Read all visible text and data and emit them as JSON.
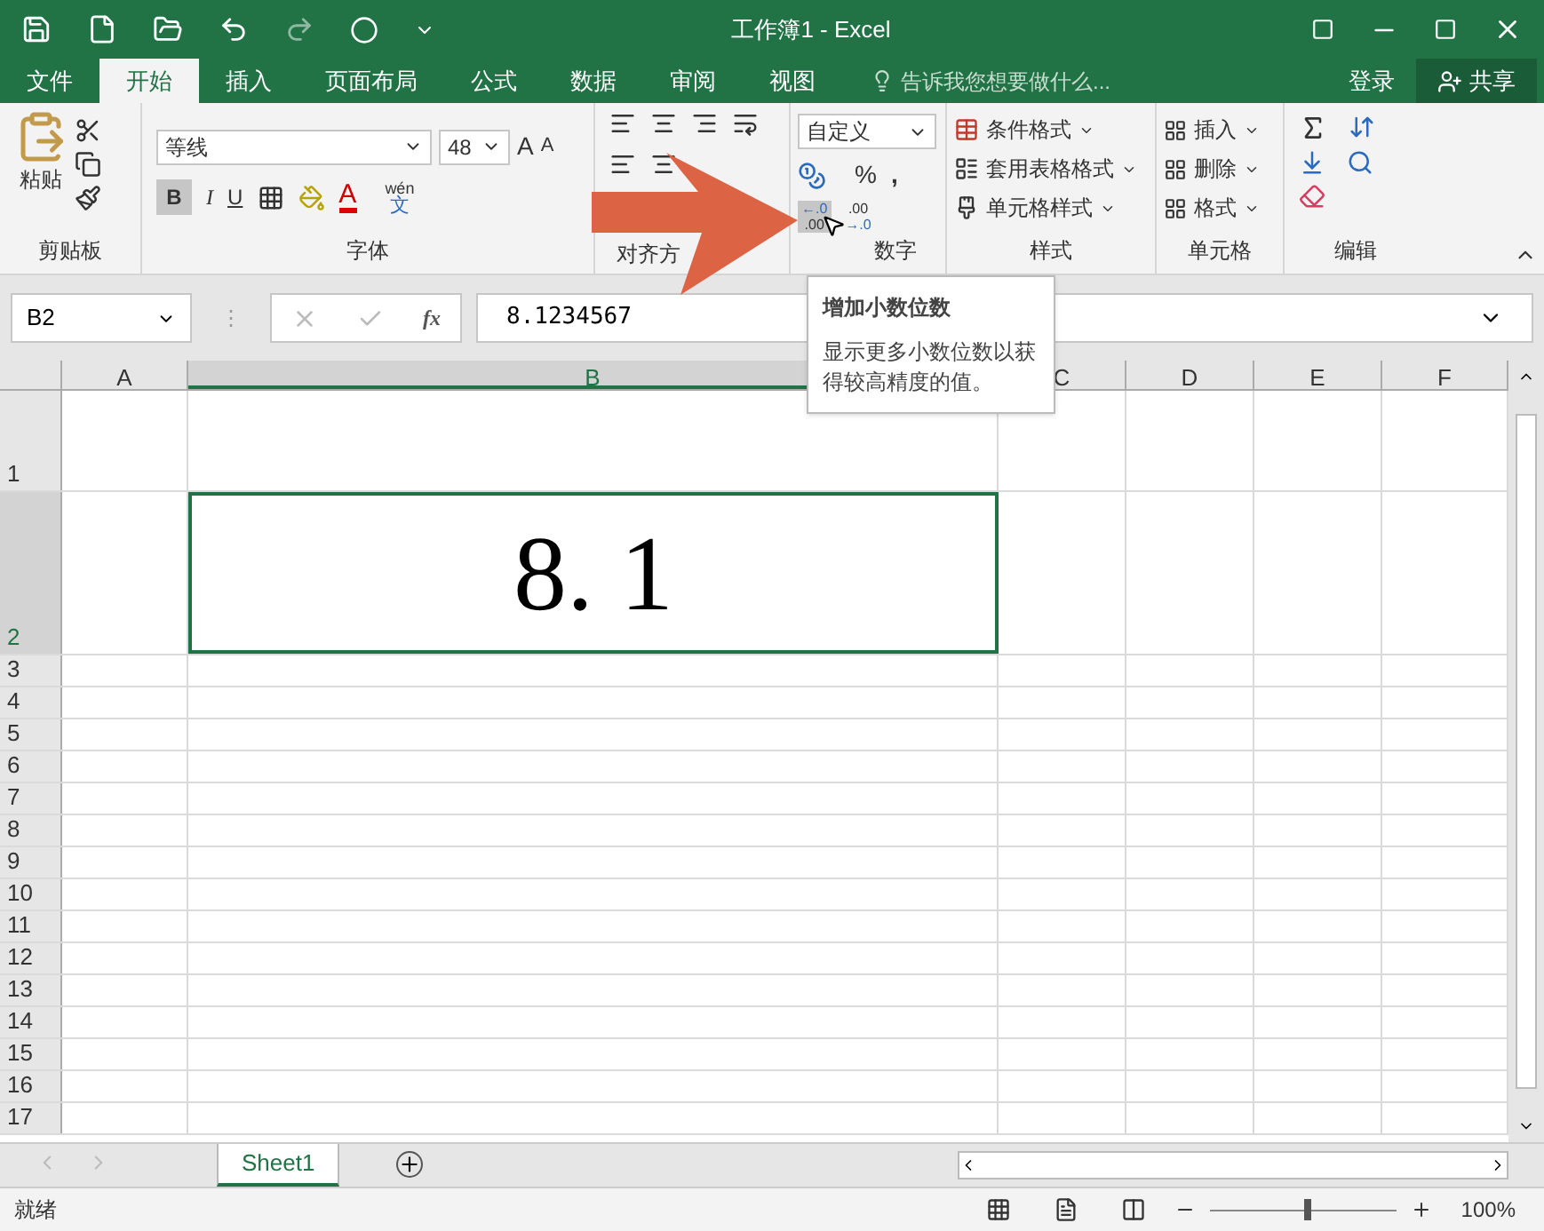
{
  "window": {
    "title": "工作簿1 - Excel"
  },
  "tabs": [
    {
      "label": "文件",
      "selected": false
    },
    {
      "label": "开始",
      "selected": true
    },
    {
      "label": "插入",
      "selected": false
    },
    {
      "label": "页面布局",
      "selected": false
    },
    {
      "label": "公式",
      "selected": false
    },
    {
      "label": "数据",
      "selected": false
    },
    {
      "label": "审阅",
      "selected": false
    },
    {
      "label": "视图",
      "selected": false
    }
  ],
  "tell_me": {
    "placeholder": "告诉我您想要做什么..."
  },
  "account": {
    "login": "登录",
    "share": "共享"
  },
  "ribbon": {
    "clipboard": {
      "paste": "粘贴",
      "label": "剪贴板"
    },
    "font": {
      "name": "等线",
      "size": "48",
      "grow": "A",
      "shrink": "A",
      "color_letter": "A",
      "bold": "B",
      "italic": "I",
      "underline": "U",
      "phonetic_top": "wén",
      "phonetic_bottom": "文",
      "label": "字体"
    },
    "alignment": {
      "label": "对齐方"
    },
    "number": {
      "format": "自定义",
      "percent": "%",
      "comma": ",",
      "increase_decimal_top": "←.0",
      "increase_decimal_bottom": ".00",
      "decrease_decimal_top": ".00",
      "decrease_decimal_bottom": "→.0",
      "label": "数字"
    },
    "styles": {
      "items": [
        "条件格式",
        "套用表格格式",
        "单元格样式"
      ],
      "label": "样式"
    },
    "cells": {
      "items": [
        "插入",
        "删除",
        "格式"
      ],
      "label": "单元格"
    },
    "editing": {
      "label": "编辑"
    }
  },
  "formula_bar": {
    "name_box": "B2",
    "separator": "⋮",
    "fx": "fx",
    "value": "8.1234567"
  },
  "columns": [
    {
      "label": "A",
      "selected": false
    },
    {
      "label": "B",
      "selected": true
    },
    {
      "label": "C",
      "selected": false
    },
    {
      "label": "D",
      "selected": false
    },
    {
      "label": "E",
      "selected": false
    },
    {
      "label": "F",
      "selected": false
    }
  ],
  "rows": [
    {
      "label": "1",
      "selected": false
    },
    {
      "label": "2",
      "selected": true
    },
    {
      "label": "3",
      "selected": false
    },
    {
      "label": "4",
      "selected": false
    },
    {
      "label": "5",
      "selected": false
    },
    {
      "label": "6",
      "selected": false
    },
    {
      "label": "7",
      "selected": false
    },
    {
      "label": "8",
      "selected": false
    },
    {
      "label": "9",
      "selected": false
    },
    {
      "label": "10",
      "selected": false
    },
    {
      "label": "11",
      "selected": false
    },
    {
      "label": "12",
      "selected": false
    },
    {
      "label": "13",
      "selected": false
    },
    {
      "label": "14",
      "selected": false
    },
    {
      "label": "15",
      "selected": false
    },
    {
      "label": "16",
      "selected": false
    },
    {
      "label": "17",
      "selected": false
    }
  ],
  "active_cell": {
    "value": "8. 1"
  },
  "tooltip": {
    "title": "增加小数位数",
    "body": "显示更多小数位数以获得较高精度的值。"
  },
  "sheets": [
    {
      "label": "Sheet1",
      "selected": true
    }
  ],
  "status_bar": {
    "status": "就绪",
    "zoom": "100%",
    "level": 0.5
  }
}
